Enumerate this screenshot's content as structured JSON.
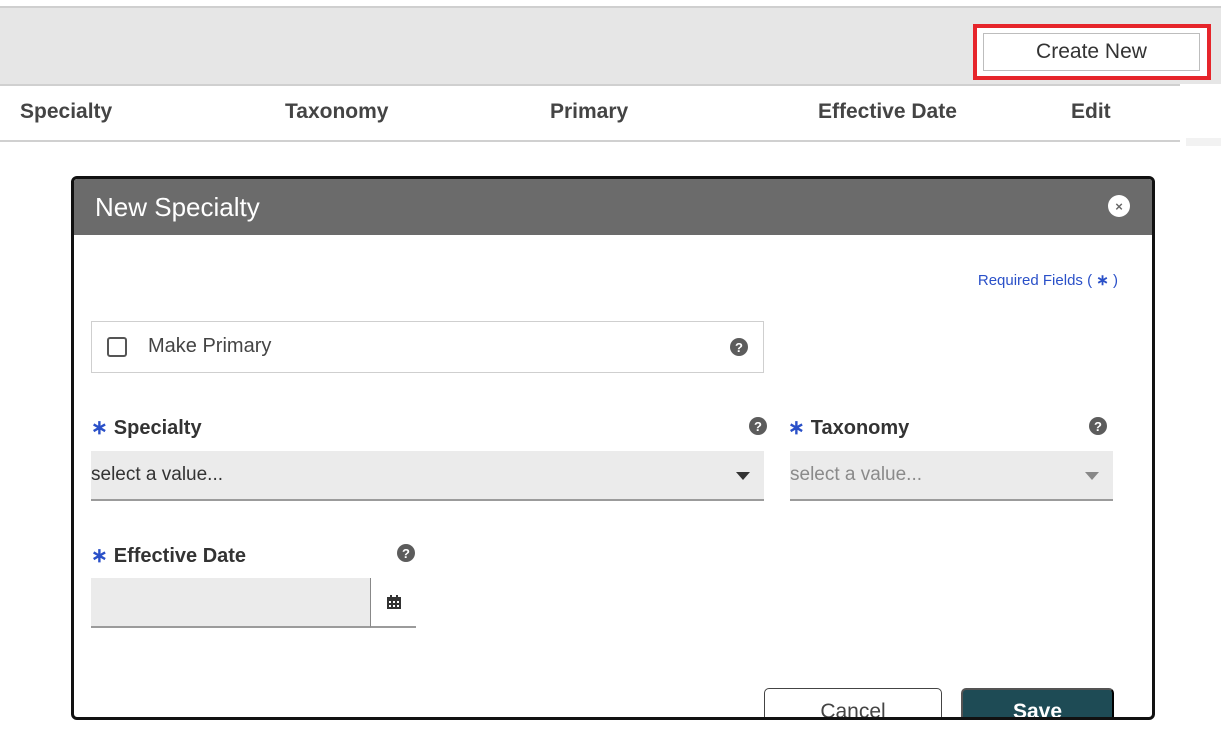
{
  "toolbar": {
    "create_new_label": "Create New"
  },
  "table": {
    "columns": [
      "Specialty",
      "Taxonomy",
      "Primary",
      "Effective Date",
      "Edit"
    ]
  },
  "modal": {
    "title": "New Specialty",
    "close_icon_glyph": "×",
    "required_fields_text": "Required Fields (",
    "required_fields_star": "∗",
    "required_fields_end": ")",
    "make_primary_label": "Make Primary",
    "help_glyph": "?",
    "required_star": "∗",
    "specialty_label": "Specialty",
    "specialty_value": "select a value...",
    "taxonomy_label": "Taxonomy",
    "taxonomy_value": "select a value...",
    "effective_date_label": "Effective Date",
    "effective_date_value": "",
    "cancel_label": "Cancel",
    "save_label": "Save"
  },
  "icons": {
    "close": "close-icon",
    "help": "help-icon",
    "calendar": "calendar-icon",
    "dropdown": "chevron-down-icon"
  },
  "colors": {
    "accent_blue": "#2a50c8",
    "header_gray": "#6b6b6b",
    "save_button": "#1e4b55",
    "highlight_red": "#e6252b"
  }
}
